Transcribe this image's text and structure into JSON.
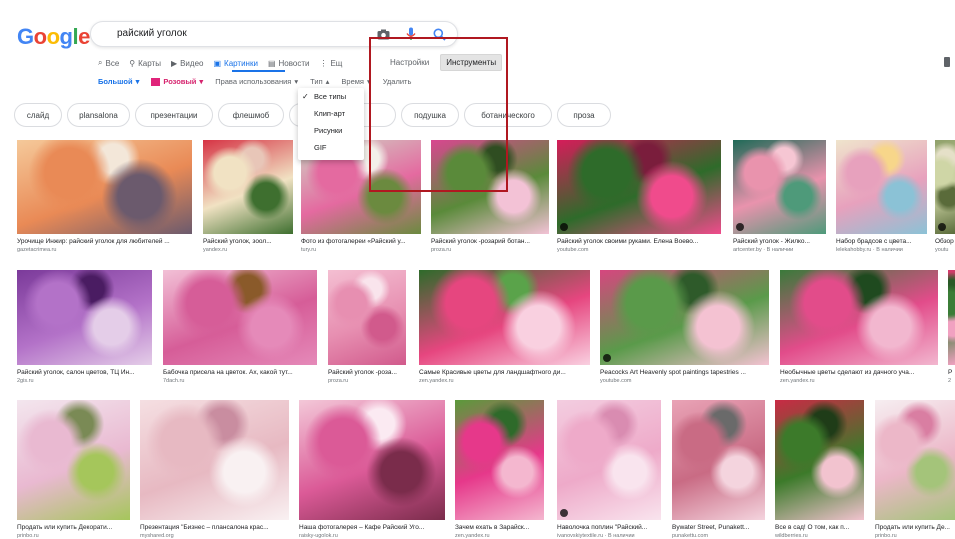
{
  "logo": {
    "text": "Google",
    "letters": [
      "G",
      "o",
      "o",
      "g",
      "l",
      "e"
    ],
    "colors": [
      "#4285f4",
      "#ea4335",
      "#fbbc05",
      "#4285f4",
      "#34a853",
      "#ea4335"
    ]
  },
  "search": {
    "query": "райский уголок",
    "icons": [
      "camera-icon",
      "mic-icon",
      "search-icon"
    ]
  },
  "tabs": [
    {
      "label": "Все",
      "icon": "search-icon",
      "glyph": "⌕",
      "active": false
    },
    {
      "label": "Карты",
      "icon": "map-pin-icon",
      "glyph": "⚲",
      "active": false
    },
    {
      "label": "Видео",
      "icon": "video-icon",
      "glyph": "▶",
      "active": false
    },
    {
      "label": "Картинки",
      "icon": "image-icon",
      "glyph": "▣",
      "active": true
    },
    {
      "label": "Новости",
      "icon": "news-icon",
      "glyph": "▤",
      "active": false
    },
    {
      "label": "Ещ",
      "icon": "more-icon",
      "glyph": "⋮",
      "active": false
    }
  ],
  "tools": {
    "settings": "Настройки",
    "tools": "Инструменты"
  },
  "filters": {
    "size": "Большой",
    "color": "Розовый",
    "rights": "Права использования",
    "type": "Тип",
    "time": "Время",
    "clear": "Удалить"
  },
  "type_menu": [
    {
      "label": "Все типы",
      "checked": true
    },
    {
      "label": "Клип-арт",
      "checked": false
    },
    {
      "label": "Рисунки",
      "checked": false
    },
    {
      "label": "GIF",
      "checked": false
    }
  ],
  "chips": [
    "слайд",
    "plansalona",
    "презентации",
    "флешмоб",
    "кр",
    "",
    "подушка",
    "ботанического",
    "проза"
  ],
  "accent": "#1a73e8",
  "highlight_color": "#b01820",
  "results": [
    {
      "caption": "Урочище Инжир: райский уголок для любителей ...",
      "source": "gazetacrimea.ru",
      "palette": [
        "#f5c99a",
        "#e98a56",
        "#6b5a6d",
        "#f3e7d9"
      ],
      "video": false
    },
    {
      "caption": "Райский уголок, зоол...",
      "source": "yandex.ru",
      "palette": [
        "#d63344",
        "#f1e2c3",
        "#3e6f2f",
        "#e8c6b8"
      ],
      "video": false
    },
    {
      "caption": "Фото из фотогалереи «Райский у...",
      "source": "tury.ru",
      "palette": [
        "#cfd6c5",
        "#e46aa0",
        "#6b8a3f",
        "#f3f0ea"
      ],
      "video": false
    },
    {
      "caption": "Райский уголок -розарий ботан...",
      "source": "proza.ru",
      "palette": [
        "#d94690",
        "#5a8a3a",
        "#f3c2d6",
        "#2f4d21"
      ],
      "video": false
    },
    {
      "caption": "Райский уголок своими руками. Елена Воево...",
      "source": "youtube.com",
      "palette": [
        "#d61c5a",
        "#2e6b2a",
        "#f04b8c",
        "#7a1d3c"
      ],
      "video": true
    },
    {
      "caption": "Райский уголок - Жилко...",
      "source": "artcenter.by · В наличии",
      "palette": [
        "#1f6a57",
        "#e993ad",
        "#4e9a7a",
        "#f6c6d3"
      ],
      "video": true
    },
    {
      "caption": "Набор брадсов с цвета...",
      "source": "lelekahobby.ru · В наличии",
      "palette": [
        "#efe4cc",
        "#e7a1bd",
        "#8bc2d6",
        "#f7d68a"
      ],
      "video": false
    },
    {
      "caption": "Обзор",
      "source": "youtu",
      "palette": [
        "#8fa06a",
        "#cfd6a6",
        "#5a6b3a",
        "#e5e0c8"
      ],
      "video": true
    },
    {
      "caption": "Райский уголок, салон цветов, ТЦ Ин...",
      "source": "2gis.ru",
      "palette": [
        "#7b3a9a",
        "#b372c8",
        "#e4cde8",
        "#4a1c62"
      ],
      "video": false
    },
    {
      "caption": "Бабочка присела на цветок. Ах, какой тут...",
      "source": "7dach.ru",
      "palette": [
        "#f2c0d6",
        "#d65d98",
        "#e58ab9",
        "#8a5a2a"
      ],
      "video": false
    },
    {
      "caption": "Райский уголок -роза...",
      "source": "proza.ru",
      "palette": [
        "#f4bfd2",
        "#e78fb1",
        "#d15a8c",
        "#f9e4ec"
      ],
      "video": false
    },
    {
      "caption": "Самые Красивые цветы для ландшафтного ди...",
      "source": "zen.yandex.ru",
      "palette": [
        "#2e6b2a",
        "#e6467f",
        "#f9d0e0",
        "#5aa34a"
      ],
      "video": false
    },
    {
      "caption": "Peacocks Art Heavenly spot paintings tapestries ...",
      "source": "youtube.com",
      "palette": [
        "#d6467f",
        "#5a9a4a",
        "#f4c2d2",
        "#2e5a2a"
      ],
      "video": true
    },
    {
      "caption": "Необычные цветы сделают из дачного уча...",
      "source": "zen.yandex.ru",
      "palette": [
        "#3a7a3a",
        "#e24c8a",
        "#f2b7cf",
        "#1f4a1f"
      ],
      "video": false
    },
    {
      "caption": "Р",
      "source": "2",
      "palette": [
        "#d8396d",
        "#3b7d37",
        "#f1a1c1",
        "#2a5a27"
      ],
      "video": false
    },
    {
      "caption": "Продать или купить Декорати...",
      "source": "prinbo.ru",
      "palette": [
        "#f3e6ee",
        "#e9b9d1",
        "#a5c65b",
        "#7a8a55"
      ],
      "video": false
    },
    {
      "caption": "Презентация \"Бизнес – плансалона крас...",
      "source": "myshared.org",
      "palette": [
        "#f5dfe2",
        "#e7b9c2",
        "#f9f1f2",
        "#c98da0"
      ],
      "video": false
    },
    {
      "caption": "Наша фотогалерея – Кафе Райский Уго...",
      "source": "raisky-ugolok.ru",
      "palette": [
        "#f3c8d8",
        "#db5a97",
        "#7a2c4b",
        "#fbeaf2"
      ],
      "video": false
    },
    {
      "caption": "Зачем ехать в Зарайск...",
      "source": "zen.yandex.ru",
      "palette": [
        "#5a9a3a",
        "#e6388a",
        "#f4b7cf",
        "#2e6a2a"
      ],
      "video": false
    },
    {
      "caption": "Наволочка поплин \"Райский...",
      "source": "ivanovskiytextile.ru · В наличии",
      "palette": [
        "#f3cde0",
        "#eeaac9",
        "#f9e4ee",
        "#d98cb1"
      ],
      "video": true
    },
    {
      "caption": "Bywater Street, Punakett...",
      "source": "punakettu.com",
      "palette": [
        "#e9a3b6",
        "#c96b84",
        "#f4d4de",
        "#6a6a6a"
      ],
      "video": false
    },
    {
      "caption": "Все в сад! О том, как п...",
      "source": "wildberries.ru",
      "palette": [
        "#c92a45",
        "#3c7a2a",
        "#f2c3cf",
        "#1f3c18"
      ],
      "video": false
    },
    {
      "caption": "Продать или купить Де...",
      "source": "prinbo.ru",
      "palette": [
        "#f6eef1",
        "#ecb7c8",
        "#a4c47a",
        "#d97ea2"
      ],
      "video": false
    }
  ]
}
